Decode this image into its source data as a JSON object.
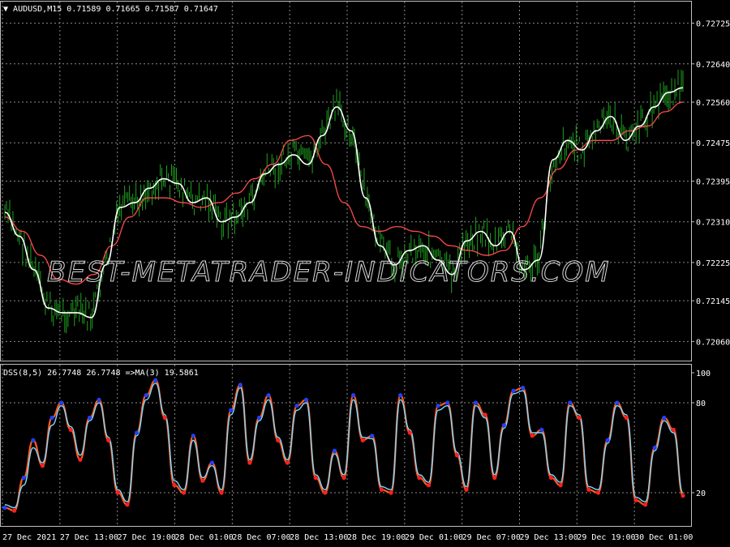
{
  "header": {
    "symbol": "AUDUSD,M15",
    "ohlc": "0.71589 0.71665 0.71587 0.71647"
  },
  "indicator_header": {
    "text": "DSS(8,5) 26.7748 26.7748 =>MA(3) 19.5861"
  },
  "watermark": "BEST-METATRADER-INDICATORS.COM",
  "colors": {
    "background": "#000000",
    "candles": "#1fa11f",
    "fast_ma": "#ffffff",
    "slow_ma": "#ff4a4a",
    "dss_line": "#ff5a1e",
    "signal_line": "#7fd8ff",
    "dots_up": "#2040ff",
    "dots_down": "#ff2020",
    "grid": "#8a8a8a",
    "text": "#ffffff"
  },
  "chart_data": [
    {
      "type": "line",
      "title": "AUDUSD,M15",
      "ylim": [
        0.7202,
        0.7277
      ],
      "y_ticks": [
        "0.72725",
        "0.72640",
        "0.72560",
        "0.72475",
        "0.72395",
        "0.72310",
        "0.72225",
        "0.72145",
        "0.72060"
      ],
      "x_ticks": [
        "27 Dec 2021",
        "27 Dec 13:00",
        "27 Dec 19:00",
        "28 Dec 01:00",
        "28 Dec 07:00",
        "28 Dec 13:00",
        "28 Dec 19:00",
        "29 Dec 01:00",
        "29 Dec 07:00",
        "29 Dec 13:00",
        "29 Dec 19:00",
        "30 Dec 01:00"
      ],
      "grid": true,
      "series": [
        {
          "values": [
            0.7233,
            0.7228,
            0.7221,
            0.7213,
            0.7212,
            0.7212,
            0.7211,
            0.7222,
            0.7234,
            0.7235,
            0.7238,
            0.724,
            0.7239,
            0.7235,
            0.7236,
            0.7231,
            0.7232,
            0.7235,
            0.7241,
            0.7243,
            0.7245,
            0.7243,
            0.7249,
            0.7255,
            0.725,
            0.7236,
            0.7226,
            0.7222,
            0.7225,
            0.7226,
            0.7223,
            0.722,
            0.7227,
            0.7229,
            0.7226,
            0.7229,
            0.7221,
            0.7223,
            0.7244,
            0.7248,
            0.7246,
            0.725,
            0.7253,
            0.7248,
            0.7251,
            0.7255,
            0.7258,
            0.7259
          ]
        },
        {
          "values": [
            0.7232,
            0.7229,
            0.7224,
            0.7219,
            0.7218,
            0.722,
            0.7226,
            0.7232,
            0.7236,
            0.7236,
            0.7235,
            0.7234,
            0.7235,
            0.7237,
            0.724,
            0.7243,
            0.7248,
            0.7249,
            0.7243,
            0.7235,
            0.723,
            0.7229,
            0.723,
            0.7229,
            0.7228,
            0.7226,
            0.7225,
            0.7224,
            0.7225,
            0.723,
            0.7236,
            0.7242,
            0.7246,
            0.7248,
            0.7248,
            0.725,
            0.7251,
            0.7254,
            0.7256
          ]
        }
      ]
    },
    {
      "type": "line",
      "title": "DSS(8,5) 26.7748 26.7748 =>MA(3) 19.5861",
      "ylim": [
        0,
        100
      ],
      "y_ticks": [
        "100",
        "80",
        "20"
      ],
      "levels": [
        80,
        20
      ],
      "series": [
        {
          "values": [
            10,
            8,
            30,
            55,
            38,
            70,
            80,
            62,
            42,
            70,
            82,
            55,
            20,
            12,
            60,
            85,
            95,
            70,
            25,
            20,
            58,
            28,
            40,
            20,
            75,
            92,
            40,
            70,
            85,
            55,
            40,
            78,
            82,
            30,
            20,
            48,
            30,
            85,
            55,
            58,
            22,
            20,
            85,
            60,
            30,
            25,
            78,
            80,
            45,
            22,
            80,
            72,
            30,
            65,
            88,
            90,
            58,
            62,
            30,
            25,
            80,
            70,
            22,
            20,
            55,
            80,
            70,
            15,
            12,
            50,
            70,
            62,
            18
          ]
        },
        {
          "values": [
            12,
            10,
            25,
            50,
            40,
            65,
            78,
            64,
            45,
            68,
            80,
            57,
            22,
            14,
            58,
            82,
            93,
            72,
            28,
            22,
            55,
            30,
            38,
            22,
            72,
            90,
            42,
            68,
            82,
            57,
            42,
            75,
            80,
            32,
            22,
            46,
            32,
            82,
            57,
            56,
            24,
            22,
            82,
            62,
            32,
            27,
            75,
            78,
            47,
            24,
            78,
            70,
            32,
            63,
            86,
            88,
            60,
            60,
            32,
            27,
            78,
            72,
            24,
            22,
            53,
            78,
            72,
            17,
            14,
            48,
            68,
            60,
            20
          ]
        }
      ]
    }
  ]
}
